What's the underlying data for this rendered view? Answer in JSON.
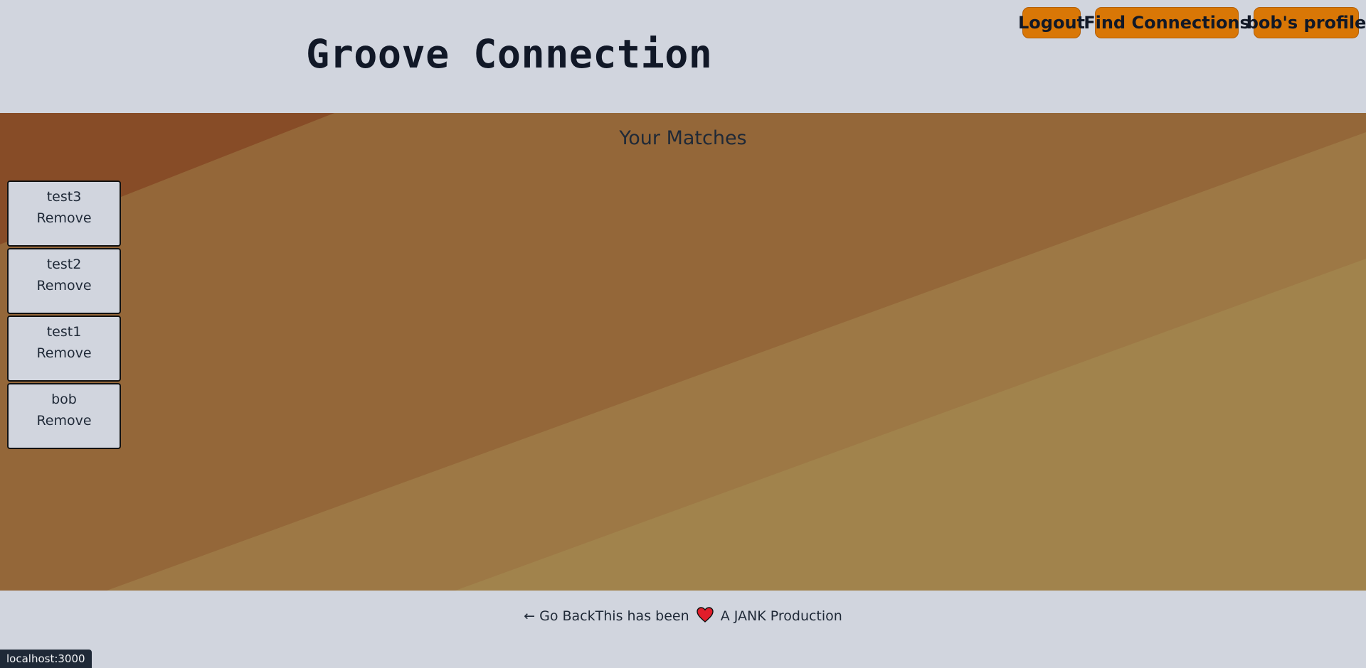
{
  "header": {
    "title": "Groove Connection",
    "nav": {
      "logout": "Logout",
      "find_connections": "Find Connections",
      "profile": "bob's profile"
    }
  },
  "main": {
    "heading": "Your Matches",
    "matches": [
      {
        "name": "test3",
        "remove_label": "Remove"
      },
      {
        "name": "test2",
        "remove_label": "Remove"
      },
      {
        "name": "test1",
        "remove_label": "Remove"
      },
      {
        "name": "bob",
        "remove_label": "Remove"
      }
    ]
  },
  "footer": {
    "go_back": "← Go Back",
    "credit_prefix": "This has been",
    "heart_icon": "heart-icon",
    "credit_suffix": "A JANK Production"
  },
  "status_bar": {
    "url": "localhost:3000"
  },
  "colors": {
    "accent": "#d97706",
    "page_bg": "#d1d5de",
    "main_bg": "#946739"
  }
}
